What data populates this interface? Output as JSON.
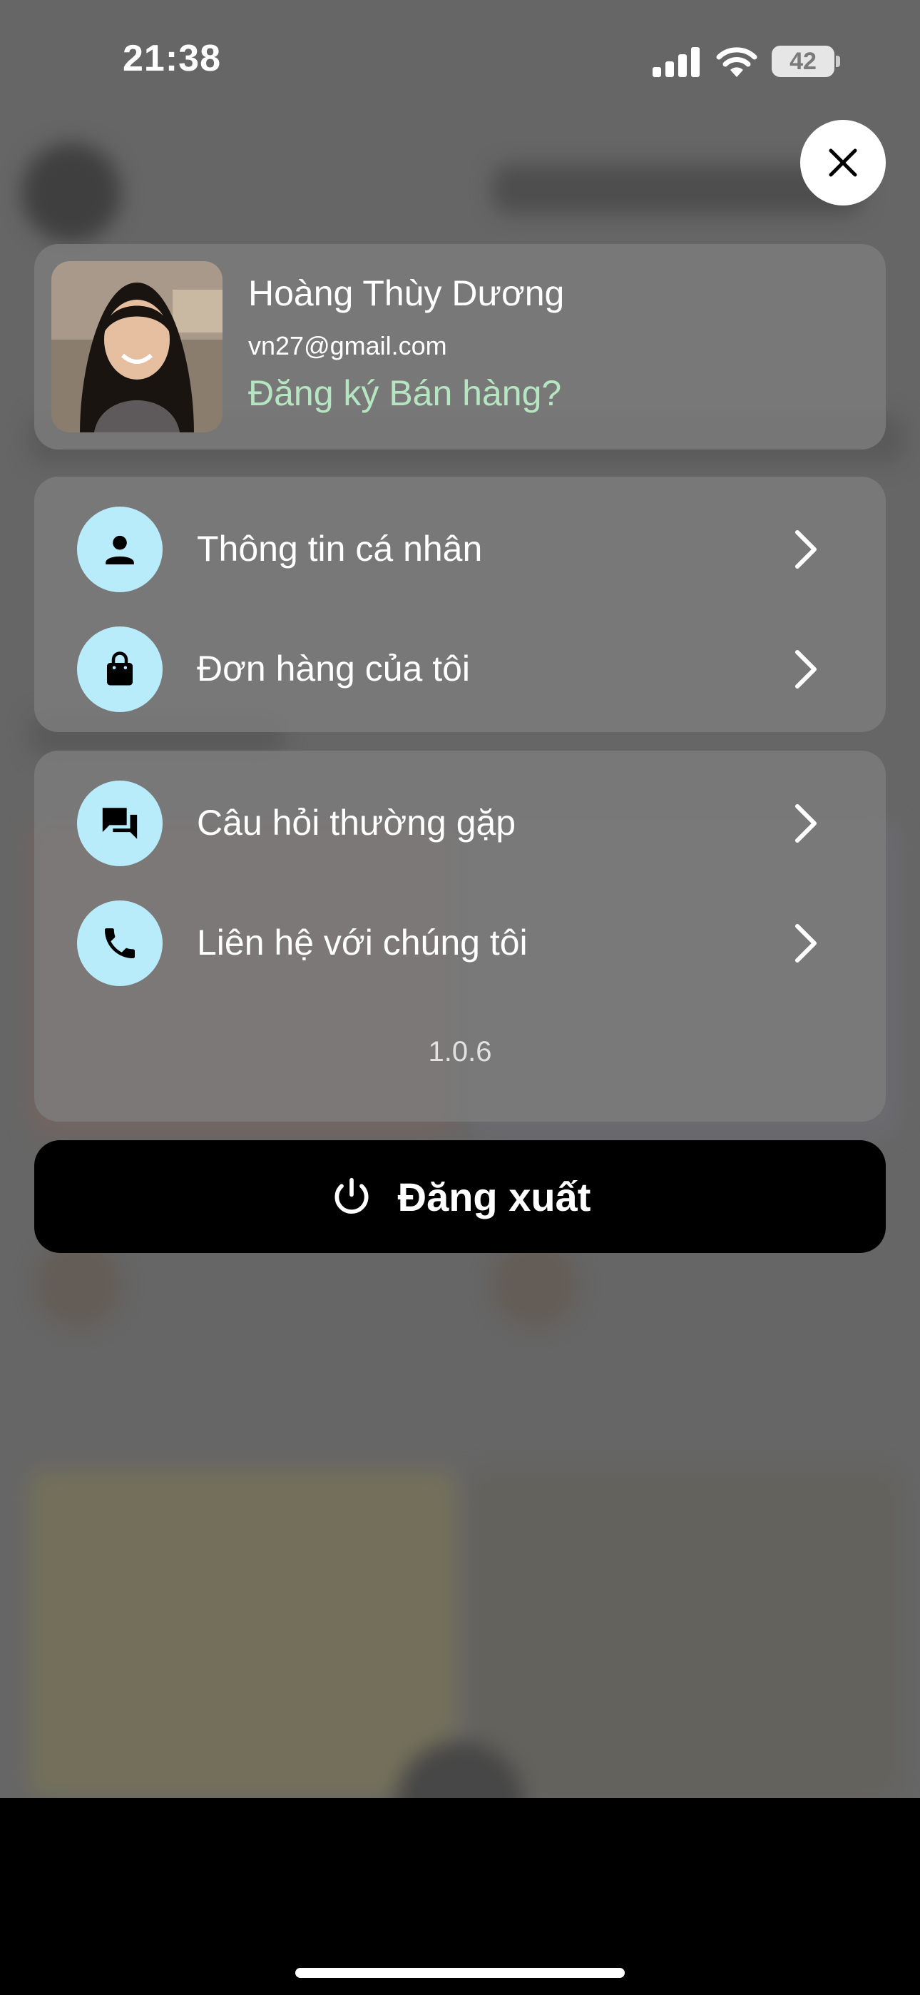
{
  "status_bar": {
    "time": "21:38",
    "battery": "42"
  },
  "profile": {
    "name": "Hoàng Thùy Dương",
    "email": "vn27@gmail.com",
    "register_link": "Đăng ký Bán hàng?"
  },
  "menu_group_1": [
    {
      "label": "Thông tin cá nhân",
      "icon": "person-icon"
    },
    {
      "label": "Đơn hàng của tôi",
      "icon": "shopping-bag-icon"
    }
  ],
  "menu_group_2": [
    {
      "label": "Câu hỏi thường gặp",
      "icon": "chat-icon"
    },
    {
      "label": "Liên hệ với chúng tôi",
      "icon": "phone-icon"
    }
  ],
  "version": "1.0.6",
  "logout_label": "Đăng xuất",
  "colors": {
    "accent_icon_bg": "#b9ecfb",
    "register_green": "#b6e6c1",
    "logout_bg": "#000000"
  }
}
